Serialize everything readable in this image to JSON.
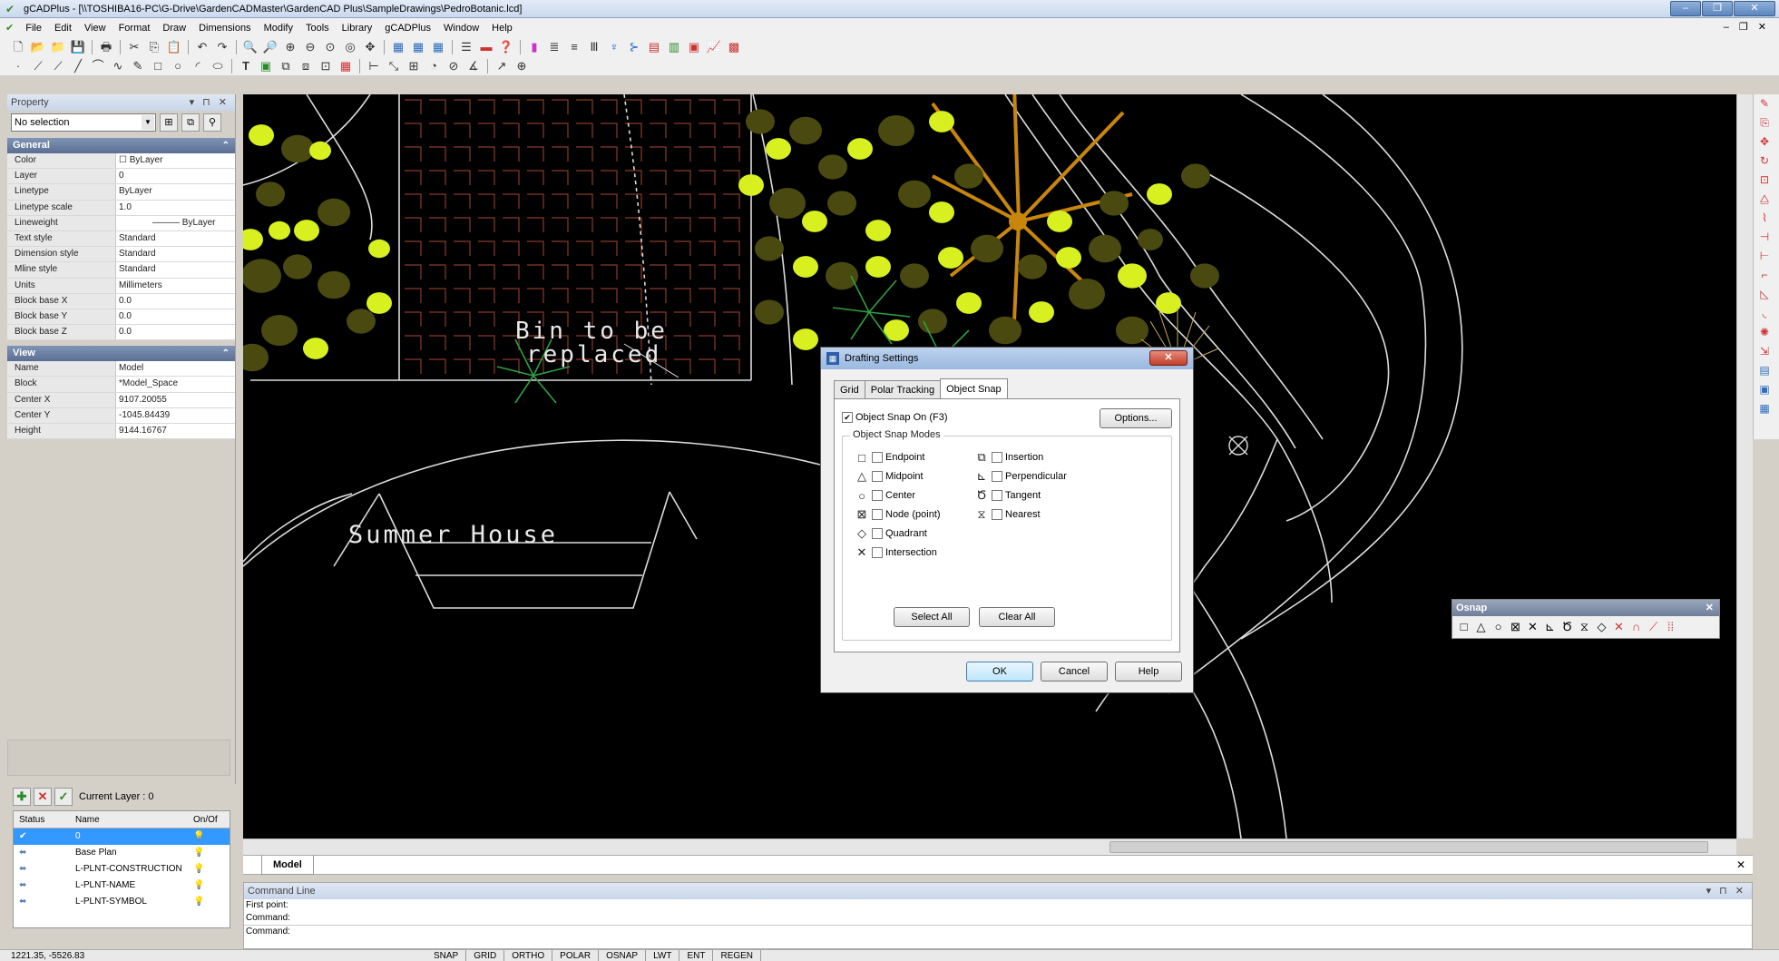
{
  "window": {
    "title": "gCADPlus - [\\\\TOSHIBA16-PC\\G-Drive\\GardenCADMaster\\GardenCAD Plus\\SampleDrawings\\PedroBotanic.lcd]"
  },
  "menu": [
    "File",
    "Edit",
    "View",
    "Format",
    "Draw",
    "Dimensions",
    "Modify",
    "Tools",
    "Library",
    "gCADPlus",
    "Window",
    "Help"
  ],
  "property_panel": {
    "title": "Property",
    "selection": "No selection",
    "general_section": "General",
    "general": [
      {
        "k": "Color",
        "v": "☐ ByLayer"
      },
      {
        "k": "Layer",
        "v": "0"
      },
      {
        "k": "Linetype",
        "v": "ByLayer"
      },
      {
        "k": "Linetype scale",
        "v": "1.0"
      },
      {
        "k": "Lineweight",
        "v": "——— ByLayer"
      },
      {
        "k": "Text style",
        "v": "Standard"
      },
      {
        "k": "Dimension style",
        "v": "Standard"
      },
      {
        "k": "Mline style",
        "v": "Standard"
      },
      {
        "k": "Units",
        "v": "Millimeters"
      },
      {
        "k": "Block base X",
        "v": "0.0"
      },
      {
        "k": "Block base Y",
        "v": "0.0"
      },
      {
        "k": "Block base Z",
        "v": "0.0"
      }
    ],
    "view_section": "View",
    "view": [
      {
        "k": "Name",
        "v": "Model"
      },
      {
        "k": "Block",
        "v": "*Model_Space"
      },
      {
        "k": "Center X",
        "v": "9107.20055"
      },
      {
        "k": "Center Y",
        "v": "-1045.84439"
      },
      {
        "k": "Height",
        "v": "9144.16767"
      }
    ]
  },
  "layers": {
    "current": "Current Layer : 0",
    "headers": [
      "Status",
      "Name",
      "On/Of"
    ],
    "rows": [
      {
        "name": "0",
        "selected": true
      },
      {
        "name": "Base Plan",
        "selected": false
      },
      {
        "name": "L-PLNT-CONSTRUCTION",
        "selected": false
      },
      {
        "name": "L-PLNT-NAME",
        "selected": false
      },
      {
        "name": "L-PLNT-SYMBOL",
        "selected": false
      }
    ]
  },
  "canvas_text": {
    "bin_line1": "Bin to be",
    "bin_line2": "replaced",
    "summer_house": "Summer House"
  },
  "model_tab": "Model",
  "command": {
    "title": "Command Line",
    "lines": [
      "First point:",
      "Command:",
      "Command:"
    ]
  },
  "status": {
    "coords": "1221.35, -5526.83",
    "buttons": [
      "SNAP",
      "GRID",
      "ORTHO",
      "POLAR",
      "OSNAP",
      "LWT",
      "ENT",
      "REGEN"
    ]
  },
  "dialog": {
    "title": "Drafting Settings",
    "tabs": [
      "Grid",
      "Polar Tracking",
      "Object Snap"
    ],
    "active_tab": "Object Snap",
    "snap_on_label": "Object Snap On (F3)",
    "snap_on_checked": true,
    "options_btn": "Options...",
    "modes_legend": "Object Snap Modes",
    "left_modes": [
      "Endpoint",
      "Midpoint",
      "Center",
      "Node (point)",
      "Quadrant",
      "Intersection"
    ],
    "right_modes": [
      "Insertion",
      "Perpendicular",
      "Tangent",
      "Nearest"
    ],
    "select_all": "Select All",
    "clear_all": "Clear All",
    "ok": "OK",
    "cancel": "Cancel",
    "help": "Help"
  },
  "osnap_toolbar": {
    "title": "Osnap"
  },
  "colors": {
    "canvas_bg": "#000000",
    "grid_lines": "#8a3b2a",
    "plant_yellow": "#d8f020",
    "plant_olive": "#4a4a10",
    "tree_orange": "#c8860c"
  }
}
